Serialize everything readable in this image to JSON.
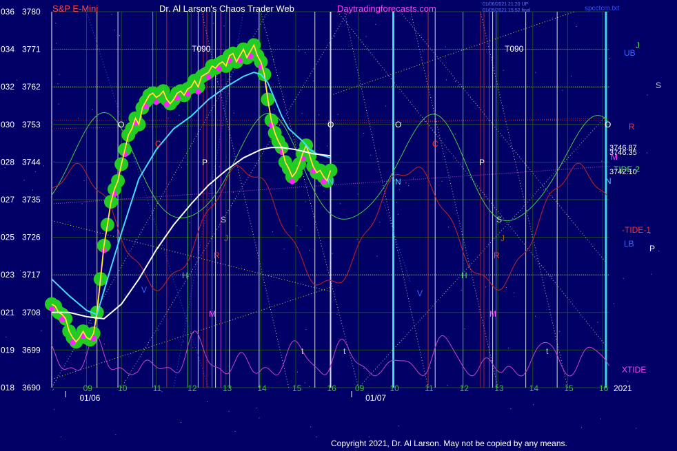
{
  "header": {
    "symbol": "S&P E-Mini",
    "title": "Dr. Al Larson's Chaos Trader Web",
    "site": "Daytradingforecasts.com",
    "stamp1": "01/06/2021 21:20 UP",
    "stamp2": "01/09/2021 15:52 final",
    "file": "spcctcm.txt"
  },
  "footer": {
    "copyright": "Copyright 2021, Dr. Al Larson. May not be copied by any means."
  },
  "colors": {
    "background": "#000066",
    "grid": "#1f4f1f",
    "price_yellow": "#ffff00",
    "price_magenta": "#ff55ff",
    "band_green": "#22cc22",
    "ma_cyan": "#44ddff",
    "ma_white": "#ffffff",
    "osc_green": "#44cc44",
    "osc_red": "#cc2222",
    "xtide": "#cc44cc",
    "header_red": "#ff4444",
    "header_magenta": "#ff44ff"
  },
  "chart_data": {
    "type": "line",
    "title": "S&P E-Mini",
    "ylim": [
      3690,
      3780
    ],
    "y_ticks": [
      {
        "left": "036",
        "right": "3780",
        "value": 3780
      },
      {
        "left": "034",
        "right": "3771",
        "value": 3771
      },
      {
        "left": "032",
        "right": "3762",
        "value": 3762
      },
      {
        "left": "030",
        "right": "3753",
        "value": 3753
      },
      {
        "left": "028",
        "right": "3744",
        "value": 3744
      },
      {
        "left": "027",
        "right": "3735",
        "value": 3735
      },
      {
        "left": "025",
        "right": "3726",
        "value": 3726
      },
      {
        "left": "023",
        "right": "3717",
        "value": 3717
      },
      {
        "left": "021",
        "right": "3708",
        "value": 3708
      },
      {
        "left": "019",
        "right": "3699",
        "value": 3699
      },
      {
        "left": "018",
        "right": "3690",
        "value": 3690
      }
    ],
    "x_ticks": [
      {
        "label": "09",
        "t": 9.0
      },
      {
        "label": "10",
        "t": 10.0
      },
      {
        "label": "11",
        "t": 11.0
      },
      {
        "label": "12",
        "t": 12.0
      },
      {
        "label": "13",
        "t": 13.0
      },
      {
        "label": "14",
        "t": 14.0
      },
      {
        "label": "15",
        "t": 15.0
      },
      {
        "label": "16",
        "t": 16.0
      },
      {
        "label": "09",
        "t": 16.8
      },
      {
        "label": "10",
        "t": 17.8
      },
      {
        "label": "11",
        "t": 18.8
      },
      {
        "label": "12",
        "t": 19.8
      },
      {
        "label": "13",
        "t": 20.8
      },
      {
        "label": "14",
        "t": 21.8
      },
      {
        "label": "15",
        "t": 22.8
      },
      {
        "label": "16",
        "t": 23.8
      }
    ],
    "date_labels": [
      {
        "text": "01/06",
        "t": 8.8
      },
      {
        "text": "01/07",
        "t": 17.0
      }
    ],
    "year_label": "2021",
    "series": [
      {
        "name": "",
        "t": [
          8.0,
          8.1,
          8.2,
          8.3,
          8.4,
          8.5,
          8.6,
          8.7,
          8.8,
          8.9,
          9.0,
          9.1,
          9.2,
          9.3,
          9.4,
          9.5,
          9.6,
          9.7,
          9.8,
          9.9,
          10.0,
          10.1,
          10.2,
          10.3,
          10.4,
          10.5,
          10.6,
          10.7,
          10.8,
          10.9,
          11.0,
          11.1,
          11.2,
          11.3,
          11.4,
          11.5,
          11.6,
          11.7,
          11.8,
          11.9,
          12.0,
          12.1,
          12.2,
          12.3,
          12.4,
          12.5,
          12.6,
          12.7,
          12.8,
          12.9,
          13.0,
          13.1,
          13.2,
          13.3,
          13.4,
          13.5,
          13.6,
          13.7,
          13.8,
          13.9,
          14.0,
          14.1,
          14.2,
          14.3,
          14.4,
          14.5,
          14.6,
          14.7,
          14.8,
          14.9,
          15.0,
          15.1,
          15.2,
          15.3,
          15.4,
          15.5,
          15.6,
          15.7,
          15.8,
          15.9,
          16.0
        ],
        "values": [
          3710.0,
          3709.5,
          3708.0,
          3707.5,
          3706.5,
          3703.5,
          3702.0,
          3701.0,
          3702.0,
          3703.5,
          3702.0,
          3701.5,
          3703.0,
          3708.0,
          3716.0,
          3724.0,
          3729.0,
          3734.5,
          3737.5,
          3739.5,
          3743.5,
          3747.0,
          3750.5,
          3752.0,
          3754.5,
          3753.0,
          3757.0,
          3758.5,
          3760.0,
          3760.5,
          3759.5,
          3760.0,
          3761.0,
          3759.0,
          3758.0,
          3759.0,
          3760.5,
          3761.0,
          3760.0,
          3761.5,
          3762.0,
          3763.5,
          3762.0,
          3764.5,
          3765.0,
          3765.5,
          3767.0,
          3766.5,
          3767.5,
          3768.0,
          3767.0,
          3769.5,
          3770.0,
          3768.0,
          3769.5,
          3771.0,
          3769.0,
          3770.5,
          3772.0,
          3769.5,
          3768.0,
          3765.0,
          3759.0,
          3754.0,
          3751.0,
          3749.0,
          3747.5,
          3744.0,
          3742.5,
          3740.5,
          3741.5,
          3743.5,
          3746.0,
          3748.0,
          3745.5,
          3743.0,
          3741.5,
          3742.0,
          3740.5,
          3739.5,
          3742.0
        ]
      },
      {
        "name": "",
        "t": [
          8.0,
          8.5,
          9.0,
          9.3,
          9.6,
          10.0,
          10.5,
          11.0,
          11.5,
          12.0,
          12.5,
          13.0,
          13.5,
          13.8,
          14.0,
          14.2,
          14.4,
          14.6,
          14.8,
          15.0,
          15.2,
          15.4,
          15.6,
          15.8,
          16.0
        ],
        "values": [
          3716.0,
          3712.0,
          3708.5,
          3707.5,
          3716.0,
          3727.0,
          3740.0,
          3747.0,
          3752.0,
          3755.0,
          3759.0,
          3762.0,
          3764.5,
          3765.5,
          3765.0,
          3763.0,
          3759.0,
          3755.0,
          3752.0,
          3750.5,
          3749.0,
          3747.0,
          3746.0,
          3745.5,
          3745.0
        ]
      },
      {
        "name": "",
        "t": [
          8.0,
          8.5,
          9.0,
          9.5,
          10.0,
          10.5,
          11.0,
          11.5,
          12.0,
          12.5,
          13.0,
          13.5,
          14.0,
          14.3,
          14.6,
          15.0,
          15.5,
          16.0
        ],
        "values": [
          3708.0,
          3708.0,
          3707.0,
          3706.5,
          3710.0,
          3716.0,
          3723.0,
          3729.0,
          3734.0,
          3738.5,
          3742.0,
          3745.0,
          3747.0,
          3747.5,
          3747.5,
          3747.0,
          3746.0,
          3745.5
        ]
      }
    ],
    "annotations": [
      {
        "text": "3746.87",
        "value": 3746.87
      },
      {
        "text": "3746.35",
        "value": 3746.35
      },
      {
        "text": "3742.10",
        "value": 3742.1
      }
    ],
    "right_labels": [
      {
        "text": "J",
        "color": "#55dd55"
      },
      {
        "text": "UB",
        "color": "#4466ff"
      },
      {
        "text": "S",
        "color": "#cccccc"
      },
      {
        "text": "R",
        "color": "#ff3333"
      },
      {
        "text": "M",
        "color": "#ff44ff"
      },
      {
        "text": "TIDE-2",
        "color": "#55dd55"
      },
      {
        "text": "N",
        "color": "#44ccff"
      },
      {
        "text": "-TIDE-1",
        "color": "#ff3333"
      },
      {
        "text": "LB",
        "color": "#4466ff"
      },
      {
        "text": "P",
        "color": "#ffffff"
      },
      {
        "text": "XTIDE",
        "color": "#ff44ff"
      }
    ],
    "markers": [
      {
        "text": "T090",
        "color": "#ffffff"
      },
      {
        "text": "T090",
        "color": "#ffffff"
      },
      {
        "text": "O",
        "color": "#ffffff"
      },
      {
        "text": "O",
        "color": "#ffffff"
      },
      {
        "text": "O",
        "color": "#ffffff"
      },
      {
        "text": "O",
        "color": "#ffffff"
      },
      {
        "text": "C",
        "color": "#ff3333"
      },
      {
        "text": "C",
        "color": "#ff3333"
      },
      {
        "text": "P",
        "color": "#ffffff"
      },
      {
        "text": "P",
        "color": "#ffffff"
      },
      {
        "text": "S",
        "color": "#cccccc"
      },
      {
        "text": "S",
        "color": "#cccccc"
      },
      {
        "text": "J",
        "color": "#aa6600"
      },
      {
        "text": "J",
        "color": "#aa6600"
      },
      {
        "text": "R",
        "color": "#ff3333"
      },
      {
        "text": "R",
        "color": "#ff3333"
      },
      {
        "text": "H",
        "color": "#55dd55"
      },
      {
        "text": "H",
        "color": "#55dd55"
      },
      {
        "text": "M",
        "color": "#ff44ff"
      },
      {
        "text": "M",
        "color": "#ff44ff"
      },
      {
        "text": "N",
        "color": "#44ccff"
      },
      {
        "text": "N",
        "color": "#44ccff"
      },
      {
        "text": "V",
        "color": "#4466ff"
      },
      {
        "text": "V",
        "color": "#4466ff"
      },
      {
        "text": "t",
        "color": "#cccccc"
      },
      {
        "text": "t",
        "color": "#cccccc"
      },
      {
        "text": "t",
        "color": "#cccccc"
      }
    ]
  }
}
